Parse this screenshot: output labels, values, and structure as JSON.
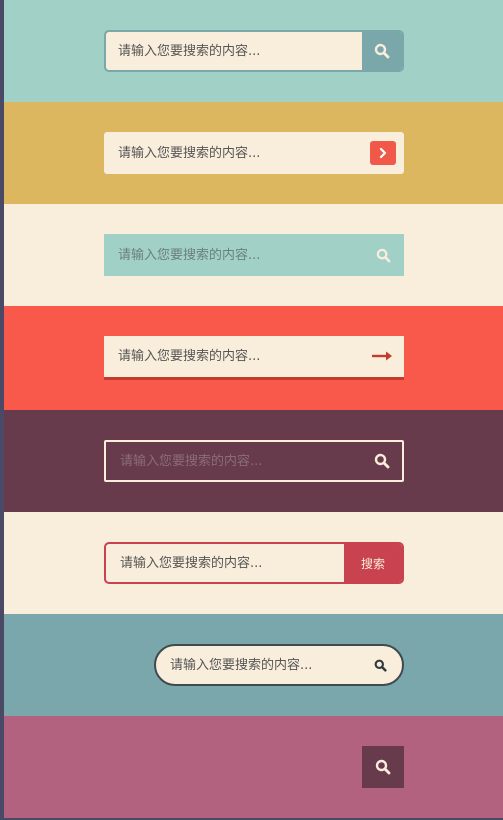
{
  "placeholder": "请输入您要搜索的内容...",
  "search_button_label": "搜索",
  "colors": {
    "mint": "#a0d0c6",
    "mustard": "#dcb75f",
    "cream": "#f9eddc",
    "coral": "#f8594a",
    "plum": "#683b4c",
    "crimson": "#c9424f",
    "teal": "#79a7ab",
    "pink": "#b2617f"
  },
  "icons": {
    "search": "search-icon",
    "chevron": "chevron-right-icon",
    "arrow": "arrow-right-icon"
  }
}
